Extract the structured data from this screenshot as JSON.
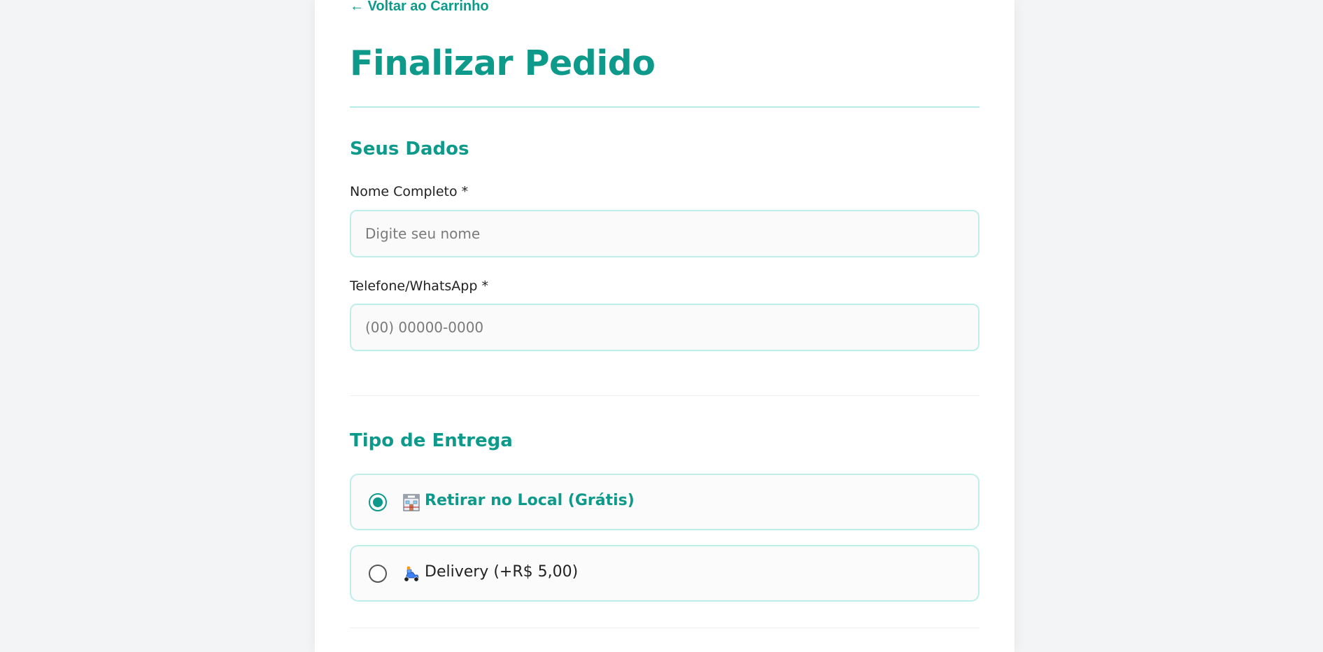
{
  "nav": {
    "back_label": "← Voltar ao Carrinho"
  },
  "page": {
    "title": "Finalizar Pedido"
  },
  "personal": {
    "section_title": "Seus Dados",
    "name_label": "Nome Completo *",
    "name_placeholder": "Digite seu nome",
    "name_value": "",
    "phone_label": "Telefone/WhatsApp *",
    "phone_placeholder": "(00) 00000-0000",
    "phone_value": ""
  },
  "delivery": {
    "section_title": "Tipo de Entrega",
    "options": [
      {
        "label": "Retirar no Local (Grátis)",
        "icon": "store-icon",
        "selected": true
      },
      {
        "label": "Delivery (+R$ 5,00)",
        "icon": "scooter-icon",
        "selected": false
      }
    ]
  },
  "colors": {
    "accent": "#0e9a8a",
    "input_border": "#bfeee9",
    "title_divider": "#b7ebe6"
  }
}
